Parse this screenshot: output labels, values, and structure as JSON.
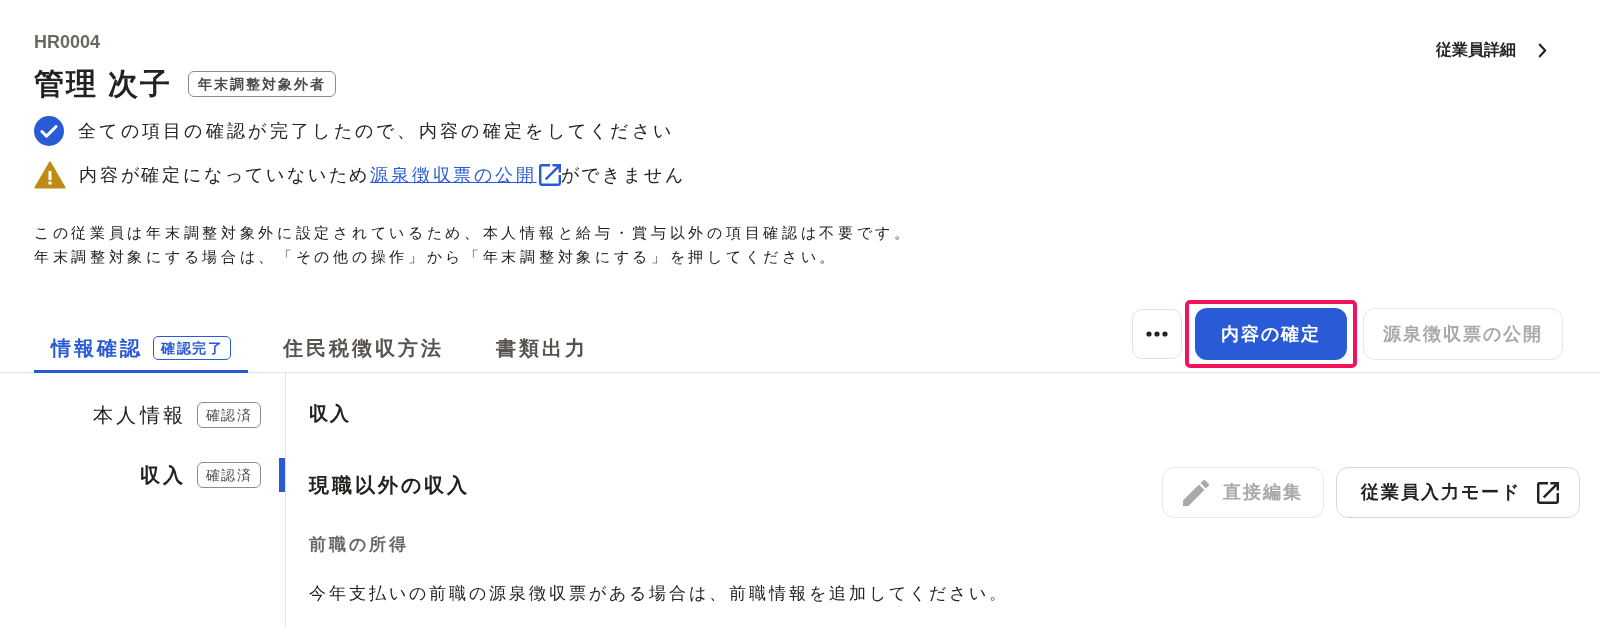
{
  "employee": {
    "code": "HR0004",
    "name": "管理 次子",
    "badge": "年末調整対象外者"
  },
  "detail_link": {
    "label": "従業員詳細"
  },
  "notices": [
    {
      "kind": "success",
      "text": "全ての項目の確認が完了したので、内容の確定をしてください"
    },
    {
      "kind": "warning",
      "text_before": "内容が確定になっていないため",
      "link": "源泉徴収票の公開",
      "text_after": "ができません"
    }
  ],
  "description": [
    "この従業員は年末調整対象外に設定されているため、本人情報と給与・賞与以外の項目確認は不要です。",
    "年末調整対象にする場合は、「その他の操作」から「年末調整対象にする」を押してください。"
  ],
  "tabs": [
    {
      "label": "情報確認",
      "badge": "確認完了",
      "selected": true
    },
    {
      "label": "住民税徴収方法",
      "selected": false
    },
    {
      "label": "書類出力",
      "selected": false
    }
  ],
  "actions": [
    {
      "kind": "more"
    },
    {
      "kind": "primary",
      "label": "内容の確定",
      "highlighted": true,
      "disabled": false
    },
    {
      "kind": "secondary",
      "label": "源泉徴収票の公開",
      "highlighted": false,
      "disabled": true
    }
  ],
  "sidebar": {
    "items": [
      {
        "label": "本人情報",
        "badge": "確認済",
        "selected": false
      },
      {
        "label": "収入",
        "badge": "確認済",
        "selected": true
      }
    ]
  },
  "content": {
    "title": "収入",
    "section": {
      "title": "現職以外の収入",
      "buttons": [
        {
          "kind": "edit",
          "label": "直接編集",
          "disabled": true
        },
        {
          "kind": "external",
          "label": "従業員入力モード",
          "disabled": false
        }
      ],
      "subtitle": "前職の所得",
      "text": "今年支払いの前職の源泉徴収票がある場合は、前職情報を追加してください。"
    }
  }
}
